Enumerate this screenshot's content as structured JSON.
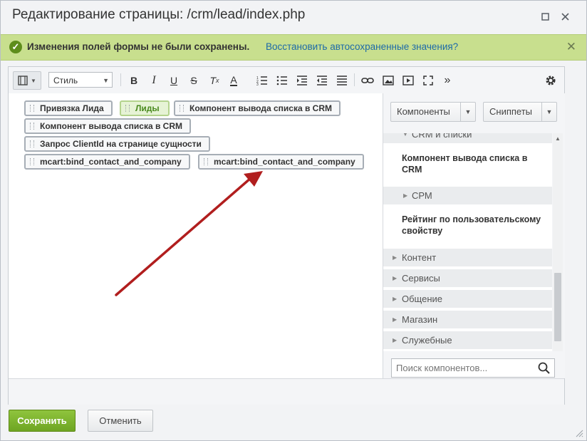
{
  "window": {
    "title": "Редактирование страницы: /crm/lead/index.php"
  },
  "notice": {
    "message": "Изменения полей формы не были сохранены.",
    "restore_link": "Восстановить автосохраненные значения?"
  },
  "toolbar": {
    "style_select": "Стиль",
    "buttons": [
      "bold",
      "italic",
      "underline",
      "strikethrough",
      "clear-format",
      "font-color",
      "ordered-list",
      "unordered-list",
      "indent",
      "outdent",
      "align",
      "link",
      "image",
      "video",
      "fullscreen",
      "more",
      "settings"
    ]
  },
  "editor": {
    "chips": [
      {
        "label": "Привязка Лида"
      },
      {
        "label": "Лиды"
      },
      {
        "label": "Компонент вывода списка в CRM"
      },
      {
        "label": "Компонент вывода списка в CRM"
      },
      {
        "label": "Запрос ClientId на странице сущности"
      },
      {
        "label": "mcart:bind_contact_and_company"
      },
      {
        "label": "mcart:bind_contact_and_company"
      }
    ]
  },
  "panel": {
    "components_button": "Компоненты",
    "snippets_button": "Сниппеты",
    "tree": {
      "crm_group": "CRM и списки",
      "crm_item": "Компонент вывода списка в CRM",
      "srm_group": "СРМ",
      "srm_item": "Рейтинг по пользовательскому свойству",
      "groups": [
        "Контент",
        "Сервисы",
        "Общение",
        "Магазин",
        "Служебные"
      ]
    },
    "search_placeholder": "Поиск компонентов..."
  },
  "footer": {
    "save": "Сохранить",
    "cancel": "Отменить"
  },
  "colors": {
    "notice_bg": "#c8df8e",
    "save_button": "#7bb32e",
    "link": "#1d6aa8",
    "annotation_arrow": "#b11e1e"
  }
}
